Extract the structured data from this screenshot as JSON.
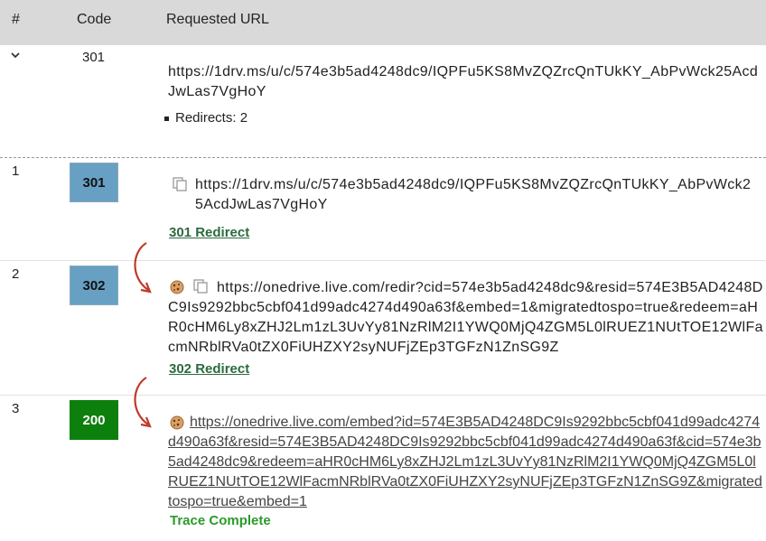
{
  "header": {
    "col_num": "#",
    "col_code": "Code",
    "col_url": "Requested URL"
  },
  "summary": {
    "code": "301",
    "url": "https://1drv.ms/u/c/574e3b5ad4248dc9/IQPFu5KS8MvZQZrcQnTUkKY_AbPvWck25AcdJwLas7VgHoY",
    "redirects_label": "Redirects: 2"
  },
  "rows": [
    {
      "num": "1",
      "code": "301",
      "url": "https://1drv.ms/u/c/574e3b5ad4248dc9/IQPFu5KS8MvZQZrcQnTUkKY_AbPvWck25AcdJwLas7VgHoY",
      "status": "301 Redirect"
    },
    {
      "num": "2",
      "code": "302",
      "url": "https://onedrive.live.com/redir?cid=574e3b5ad4248dc9&resid=574E3B5AD4248DC9Is9292bbc5cbf041d99adc4274d490a63f&embed=1&migratedtospo=true&redeem=aHR0cHM6Ly8xZHJ2Lm1zL3UvYy81NzRlM2I1YWQ0MjQ4ZGM5L0lRUEZ1NUtTOE12WlFacmNRblRVa0tZX0FiUHZXY2syNUFjZEp3TGFzN1ZnSG9Z",
      "status": "302 Redirect"
    },
    {
      "num": "3",
      "code": "200",
      "url": "https://onedrive.live.com/embed?id=574E3B5AD4248DC9Is9292bbc5cbf041d99adc4274d490a63f&resid=574E3B5AD4248DC9Is9292bbc5cbf041d99adc4274d490a63f&cid=574e3b5ad4248dc9&redeem=aHR0cHM6Ly8xZHJ2Lm1zL3UvYy81NzRlM2I1YWQ0MjQ4ZGM5L0lRUEZ1NUtTOE12WlFacmNRblRVa0tZX0FiUHZXY2syNUFjZEp3TGFzN1ZnSG9Z&migratedtospo=true&embed=1",
      "status": "Trace Complete"
    }
  ],
  "icons": {
    "expand": "chevron-down-icon",
    "copy": "copy-icon",
    "cookie": "cookie-icon",
    "arrow": "redirect-arrow-icon"
  },
  "colors": {
    "header_bg": "#d9d9d9",
    "badge_redirect": "#67a0c3",
    "badge_ok": "#0d7f0d",
    "arrow": "#c0392b",
    "complete": "#2a9a2a"
  }
}
